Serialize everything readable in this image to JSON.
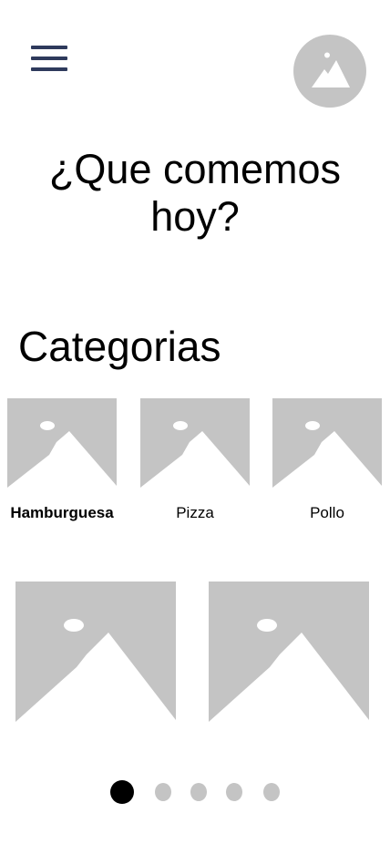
{
  "header": {
    "menu_icon": "hamburger-menu-icon",
    "avatar_icon": "image-placeholder-icon"
  },
  "main": {
    "title": "¿Que comemos hoy?",
    "section_title": "Categorias"
  },
  "categories": [
    {
      "label": "Hamburguesa",
      "icon": "image-placeholder-icon",
      "selected": true
    },
    {
      "label": "Pizza",
      "icon": "image-placeholder-icon",
      "selected": false
    },
    {
      "label": "Pollo",
      "icon": "image-placeholder-icon",
      "selected": false
    }
  ],
  "featured": [
    {
      "icon": "image-placeholder-icon"
    },
    {
      "icon": "image-placeholder-icon"
    }
  ],
  "pagination": {
    "total": 5,
    "current": 1
  },
  "colors": {
    "menu_icon": "#2e3a5c",
    "placeholder": "#c4c4c4",
    "text": "#000000",
    "active_dot": "#000000",
    "inactive_dot": "#c4c4c4"
  }
}
